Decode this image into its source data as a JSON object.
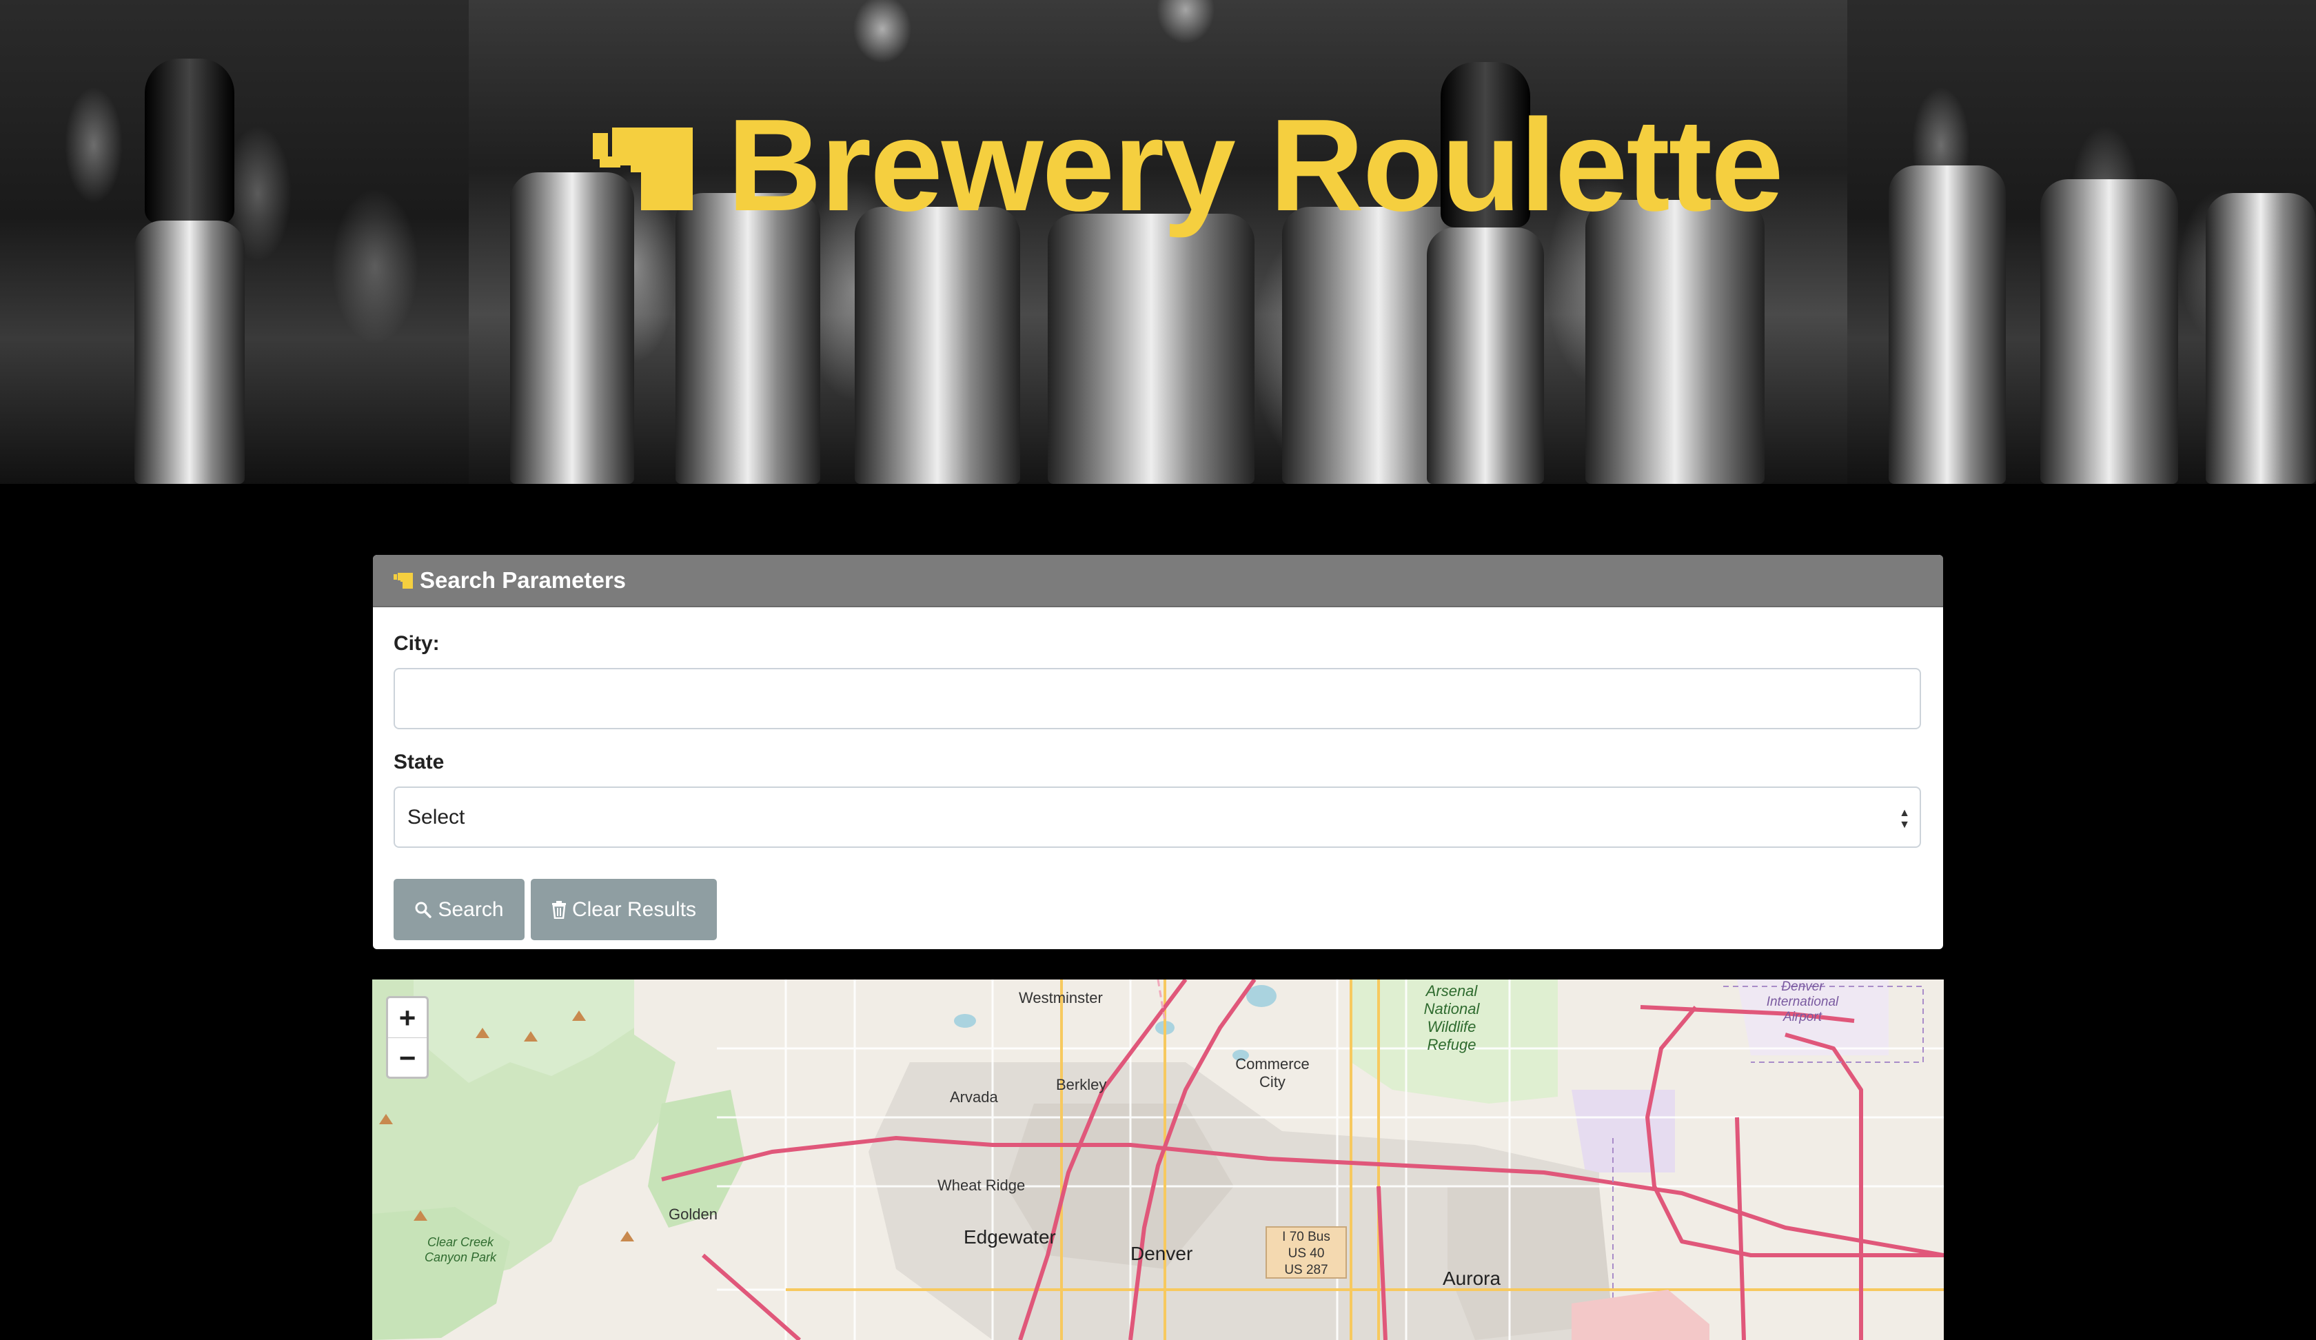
{
  "app": {
    "title": "Brewery Roulette",
    "brand_color": "#f5cf3f"
  },
  "search_panel": {
    "title": "Search Parameters",
    "city_label": "City:",
    "city_value": "",
    "state_label": "State",
    "state_selected": "Select",
    "search_button": "Search",
    "clear_button": "Clear Results",
    "button_color": "#8f9ea2",
    "header_color": "#7c7c7c"
  },
  "map": {
    "zoom_in": "+",
    "zoom_out": "−",
    "places": {
      "denver": "Denver",
      "aurora": "Aurora",
      "edgewater": "Edgewater",
      "wheat_ridge": "Wheat Ridge",
      "arvada": "Arvada",
      "berkley": "Berkley",
      "westminster": "Westminster",
      "commerce_city": "Commerce City",
      "golden": "Golden",
      "clear_creek_canyon_park": "Clear Creek Canyon Park",
      "arsenal_refuge": "Arsenal National Wildlife Refuge",
      "denver_airport": "Denver International Airport"
    },
    "highway_sign": [
      "I 70 Bus",
      "US 40",
      "US 287"
    ]
  }
}
